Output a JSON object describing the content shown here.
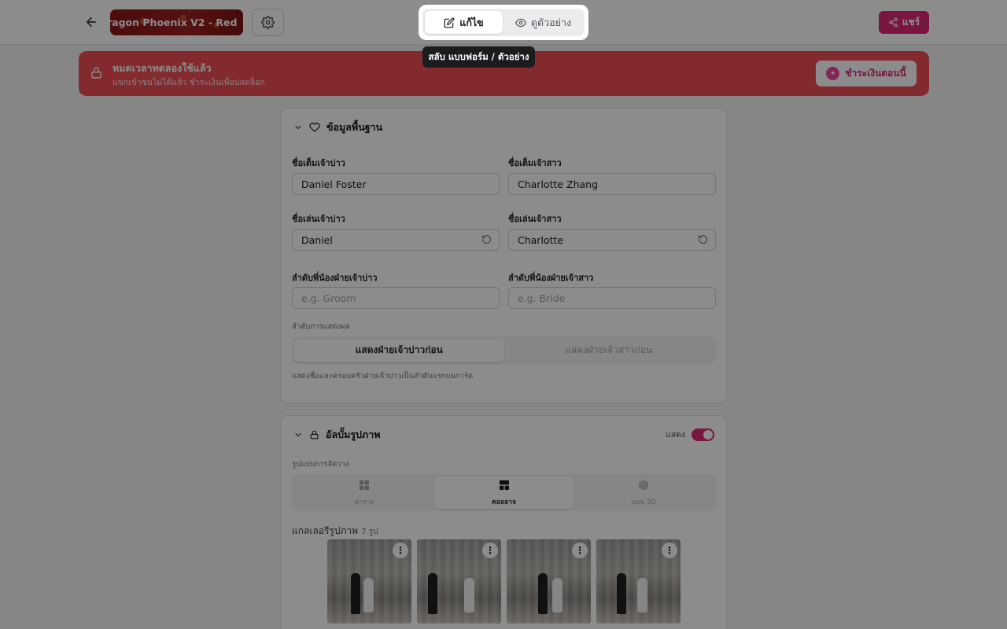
{
  "header": {
    "template_name": "ragon Phoenix V2 - Red",
    "mode_tabs": [
      {
        "label": "แก้ไข",
        "icon": "edit-icon",
        "active": true
      },
      {
        "label": "ดูตัวอย่าง",
        "icon": "eye-icon",
        "active": false
      }
    ],
    "tooltip": "สลับ แบบฟอร์ม / ตัวอย่าง",
    "share_label": "แชร์",
    "accent_color": "#db2777"
  },
  "banner": {
    "title": "หมดเวลาทดลองใช้แล้ว",
    "subtitle": "แขกเข้าชมไม่ได้แล้ว ชำระเงินเพื่อปลดล็อก",
    "pay_label": "ชำระเงินตอนนี้",
    "color": "#ef4e56"
  },
  "basic_info": {
    "section_title": "ข้อมูลพื้นฐาน",
    "groom_full_name_label": "ชื่อเต็มเจ้าบ่าว",
    "groom_full_name": "Daniel Foster",
    "bride_full_name_label": "ชื่อเต็มเจ้าสาว",
    "bride_full_name": "Charlotte Zhang",
    "groom_nickname_label": "ชื่อเล่นเจ้าบ่าว",
    "groom_nickname": "Daniel",
    "bride_nickname_label": "ชื่อเล่นเจ้าสาว",
    "bride_nickname": "Charlotte",
    "groom_sibling_label": "ลำดับพี่น้องฝ่ายเจ้าบ่าว",
    "groom_sibling_placeholder": "e.g. Groom",
    "bride_sibling_label": "ลำดับพี่น้องฝ่ายเจ้าสาว",
    "bride_sibling_placeholder": "e.g. Bride",
    "display_order_label": "ลำดับการแสดงผล",
    "display_order_options": [
      "แสดงฝ่ายเจ้าบ่าวก่อน",
      "แสดงฝ่ายเจ้าสาวก่อน"
    ],
    "display_order_selected": 0,
    "display_order_help": "แสดงชื่อและครอบครัวฝ่ายเจ้าบ่าวเป็นลำดับแรกบนการ์ด"
  },
  "album": {
    "section_title": "อัลบั้มรูปภาพ",
    "show_label": "แสดง",
    "show_enabled": true,
    "layout_label": "รูปแบบการจัดวาง",
    "layout_options": [
      {
        "label": "ตาราง",
        "icon": "grid-icon"
      },
      {
        "label": "คอลลาจ",
        "icon": "collage-icon"
      },
      {
        "label": "แบบ 3D",
        "icon": "cube-3d-icon"
      }
    ],
    "layout_selected": 1,
    "gallery_label": "แกลเลอรีรูปภาพ",
    "gallery_count": "7 รูป",
    "photos": [
      "photo-1",
      "photo-2",
      "photo-3",
      "photo-4"
    ]
  }
}
